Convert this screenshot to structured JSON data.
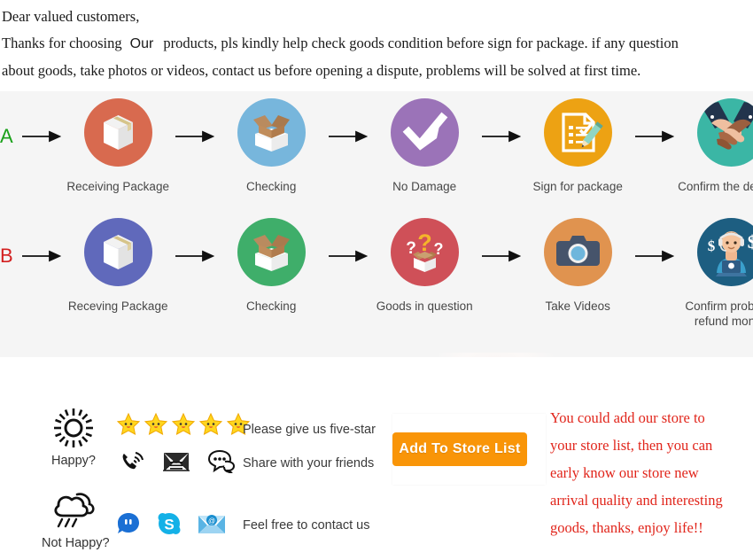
{
  "intro": {
    "line1": "Dear valued customers,",
    "line2_before": "Thanks for choosing",
    "line2_our": "Our",
    "line2_after": "products, pls kindly help check goods condition before sign for package. if any question",
    "line3": "about goods, take photos or videos, contact us before opening a dispute, problems will be solved at first time."
  },
  "flow": {
    "row_a": {
      "letter": "A",
      "letter_color": "#1aa11a",
      "steps": [
        {
          "label": "Receiving Package",
          "icon": "closed-box-icon",
          "circle_color": "#d86a4f"
        },
        {
          "label": "Checking",
          "icon": "open-box-icon",
          "circle_color": "#77b6dc"
        },
        {
          "label": "No Damage",
          "icon": "checkmark-icon",
          "circle_color": "#9b73b8"
        },
        {
          "label": "Sign for package",
          "icon": "signed-document-icon",
          "circle_color": "#eda213"
        },
        {
          "label": "Confirm the delivery",
          "icon": "handshake-icon",
          "circle_color": "#3bb6a5"
        }
      ]
    },
    "row_b": {
      "letter": "B",
      "letter_color": "#d32020",
      "steps": [
        {
          "label": "Receving Package",
          "icon": "closed-box-icon",
          "circle_color": "#6069bb"
        },
        {
          "label": "Checking",
          "icon": "open-box-icon",
          "circle_color": "#3fae6a"
        },
        {
          "label": "Goods in question",
          "icon": "question-box-icon",
          "circle_color": "#cf5058"
        },
        {
          "label": "Take Videos",
          "icon": "camera-icon",
          "circle_color": "#e0934f"
        },
        {
          "label": "Confirm problem,\nrefund money",
          "label_l1": "Confirm problem,",
          "label_l2": "refund money",
          "icon": "support-agent-icon",
          "circle_color": "#1d5e81"
        }
      ]
    },
    "arrow_glyph": "arrow-right-icon"
  },
  "feedback": {
    "happy_label": "Happy?",
    "happy_icon": "sun-icon",
    "not_happy_label": "Not Happy?",
    "not_happy_icon": "rain-cloud-icon",
    "star_count": 5,
    "star_color": "#ffd61e",
    "message_five_star": "Please give us five-star",
    "message_share": "Share with your friends",
    "message_contact": "Feel free to contact us",
    "contact_icons_row1": [
      "phone-ringing-icon",
      "envelope-icon",
      "chat-bubble-icon"
    ],
    "contact_icons_row2": [
      "trademanager-icon",
      "skype-icon",
      "email-at-icon"
    ]
  },
  "store": {
    "button_label": "Add To Store List",
    "button_color": "#f99508",
    "promo_color": "#e1251b",
    "promo_lines": [
      "You could add our store to",
      "your store list, then you can",
      "early know our store new",
      "arrival quality and interesting",
      "goods, thanks, enjoy life!!"
    ]
  }
}
